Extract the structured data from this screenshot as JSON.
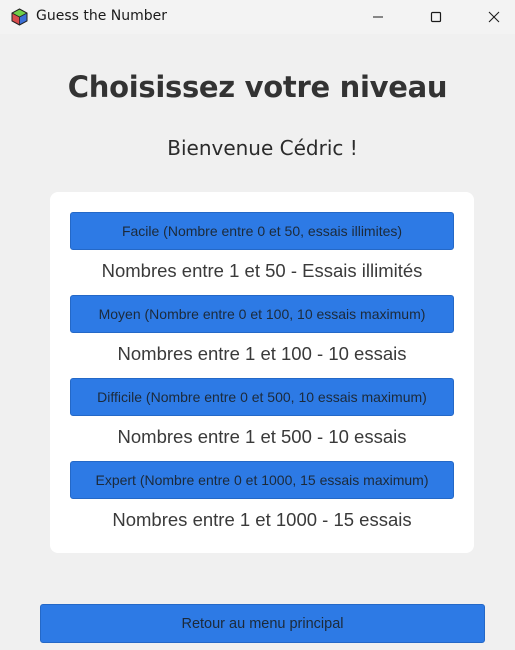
{
  "window": {
    "title": "Guess the Number",
    "icon": "cube-icon"
  },
  "main": {
    "heading": "Choisissez votre niveau",
    "welcome": "Bienvenue Cédric !"
  },
  "levels": [
    {
      "button": "Facile (Nombre entre 0 et 50, essais illimites)",
      "description": "Nombres entre 1 et 50 - Essais illimités"
    },
    {
      "button": "Moyen (Nombre entre 0 et 100, 10 essais maximum)",
      "description": "Nombres entre 1 et 100 - 10 essais"
    },
    {
      "button": "Difficile (Nombre entre 0 et 500, 10 essais maximum)",
      "description": "Nombres entre 1 et 500 - 10 essais"
    },
    {
      "button": "Expert (Nombre entre 0 et 1000, 15 essais maximum)",
      "description": "Nombres entre 1 et 1000 - 15 essais"
    }
  ],
  "footer": {
    "back_label": "Retour au menu principal"
  },
  "colors": {
    "accent": "#2d7ae5",
    "background": "#f0f0f0",
    "card": "#ffffff"
  }
}
